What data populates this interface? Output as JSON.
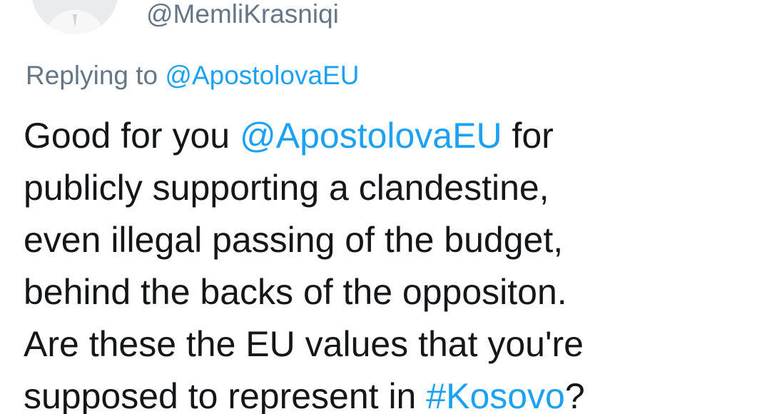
{
  "author": {
    "handle": "@MemliKrasniqi"
  },
  "reply": {
    "prefix": "Replying to",
    "target": "@ApostolovaEU"
  },
  "tweet": {
    "line1_before": "Good for you",
    "mention": "@ApostolovaEU",
    "line1_after": "for",
    "line2": "publicly supporting a clandestine,",
    "line3": "even illegal passing of the budget,",
    "line4": "behind the backs of the oppositon.",
    "line5": "Are these the EU values that you're",
    "line6_before": "supposed to represent in",
    "hashtag": "#Kosovo",
    "line6_after": "?"
  },
  "colors": {
    "link": "#1da1f2",
    "secondary_text": "#657786",
    "primary_text": "#14171a"
  }
}
